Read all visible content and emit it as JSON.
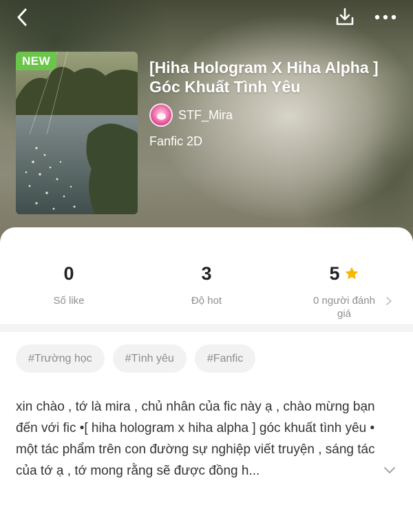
{
  "header": {
    "back_icon": "chevron-left-icon",
    "download_icon": "download-icon",
    "more_icon": "more-horizontal-icon"
  },
  "story": {
    "badge": "NEW",
    "title": "[Hiha Hologram X Hiha Alpha ] Góc Khuất Tình Yêu",
    "author": "STF_Mira",
    "genre": "Fanfic 2D"
  },
  "stats": {
    "likes": {
      "value": "0",
      "label": "Số like"
    },
    "hot": {
      "value": "3",
      "label": "Độ hot"
    },
    "rating": {
      "value": "5",
      "label": "0 người đánh giá",
      "icon": "star-icon"
    }
  },
  "tags": [
    "#Trường học",
    "#Tình yêu",
    "#Fanfic"
  ],
  "description": "xin chào , tớ là mira , chủ nhân của fic này ạ , chào mừng bạn đến với fic •[ hiha hologram x hiha alpha  ] góc khuất tình yêu • một tác phẩm trên con đường sự nghiệp viết truyện , sáng tác của tớ ạ , tớ mong rằng sẽ được đồng h...",
  "colors": {
    "badge_green": "#6bc54a",
    "star_yellow": "#f5b800",
    "muted_text": "#8e8e8e",
    "tag_bg": "#f2f2f2"
  }
}
